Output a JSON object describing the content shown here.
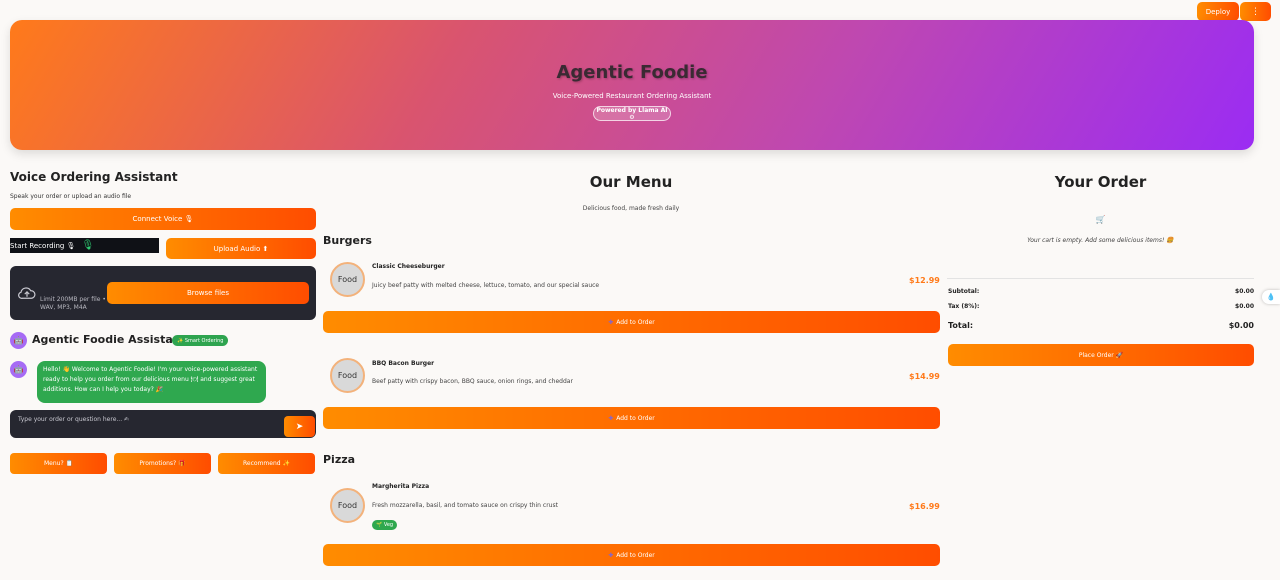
{
  "toolbar": {
    "deploy_label": "Deploy",
    "menu_label": "⋮"
  },
  "hero": {
    "title": "Agentic Foodie",
    "subtitle": "Voice-Powered Restaurant Ordering Assistant",
    "badge": "Powered by Llama AI ⚙"
  },
  "voice": {
    "title": "Voice Ordering Assistant",
    "description": "Speak your order or upload an audio file",
    "connect_label": "Connect Voice 🎙",
    "start_recording_label": "Start Recording 🎙",
    "mic_icon": "🎙",
    "upload_label": "Upload Audio ⬆",
    "dropzone": {
      "limit_text": "Limit 200MB per file • WAV, MP3, M4A",
      "browse_label": "Browse files"
    }
  },
  "assistant": {
    "avatar": "🤖",
    "title": "Agentic Foodie Assistant",
    "badge": "✨ Smart Ordering",
    "message": "Hello! 👋 Welcome to Agentic Foodie! I'm your voice-powered assistant ready to help you order from our delicious menu 🍽 and suggest great additions. How can I help you today? 🎉",
    "input_placeholder": "Type your order or question here... ✍",
    "send_label": "➤",
    "quick_actions": {
      "menu": "Menu? 📋",
      "promotions": "Promotions? 🎁",
      "recommend": "Recommend ✨"
    }
  },
  "menu": {
    "title": "Our Menu",
    "subtitle": "Delicious food, made fresh daily",
    "add_label": "Add to Order",
    "add_icon": "✚",
    "sections": [
      {
        "name": "Burgers"
      },
      {
        "name": "Pizza"
      }
    ],
    "items": [
      {
        "image_label": "Food",
        "name": "Classic Cheeseburger",
        "description": "Juicy beef patty with melted cheese, lettuce, tomato, and our special sauce",
        "price": "$12.99"
      },
      {
        "image_label": "Food",
        "name": "BBQ Bacon Burger",
        "description": "Beef patty with crispy bacon, BBQ sauce, onion rings, and cheddar",
        "price": "$14.99"
      },
      {
        "image_label": "Food",
        "name": "Margherita Pizza",
        "description": "Fresh mozzarella, basil, and tomato sauce on crispy thin crust",
        "price": "$16.99",
        "tag": "🌱 Veg"
      }
    ]
  },
  "order": {
    "title": "Your Order",
    "cart_icon": "🛒",
    "empty_message": "Your cart is empty. Add some delicious items! 🍔",
    "subtotal_label": "Subtotal:",
    "subtotal_value": "$0.00",
    "tax_label": "Tax (8%):",
    "tax_value": "$0.00",
    "total_label": "Total:",
    "total_value": "$0.00",
    "place_order_label": "Place Order 🚀"
  },
  "side_tab_icon": "💧",
  "colors": {
    "accent": "#ff7a1a",
    "gradient_end": "#9b2cf3",
    "success": "#2fa84f",
    "dark_panel": "#262730"
  }
}
